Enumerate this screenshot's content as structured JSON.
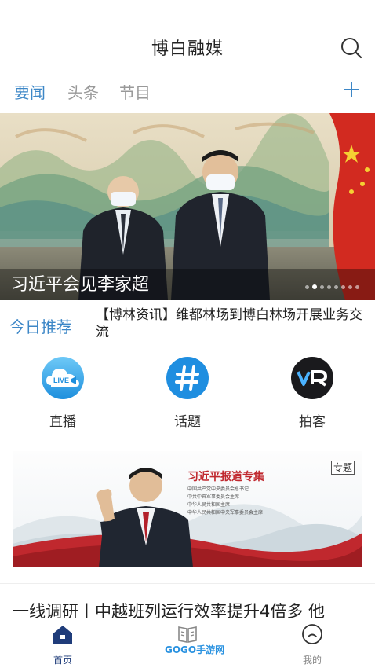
{
  "app": {
    "title": "博白融媒"
  },
  "tabs": [
    {
      "label": "要闻",
      "active": true
    },
    {
      "label": "头条",
      "active": false
    },
    {
      "label": "节目",
      "active": false
    }
  ],
  "banner": {
    "caption": "习近平会见李家超",
    "slide_count": 8,
    "active_index": 1
  },
  "today": {
    "label": "今日推荐",
    "text": "【博林资讯】维都林场到博白林场开展业务交流"
  },
  "features": [
    {
      "label": "直播",
      "icon": "live-cloud-icon",
      "badge": "LIVE"
    },
    {
      "label": "话题",
      "icon": "hashtag-icon",
      "badge": "#"
    },
    {
      "label": "拍客",
      "icon": "vr-logo-icon",
      "badge": "VR"
    }
  ],
  "promo": {
    "title": "习近平报道专集",
    "tag": "专题",
    "lines": [
      "中国共产党中央委员会总书记",
      "中共中央军事委员会主席",
      "中华人民共和国主席",
      "中华人民共和国中央军事委员会主席"
    ]
  },
  "headline": "一线调研丨中越班列运行效率提升4倍多 他",
  "bottom_nav": [
    {
      "label": "首页",
      "icon": "home-icon",
      "active": true
    },
    {
      "label": "",
      "icon": "book-icon",
      "active": false
    },
    {
      "label": "我的",
      "icon": "profile-icon",
      "active": false
    }
  ],
  "watermark": "GOGO手游网",
  "colors": {
    "accent": "#3d87c7",
    "nav_active": "#1f3c7a",
    "promo_red": "#c0282e"
  }
}
